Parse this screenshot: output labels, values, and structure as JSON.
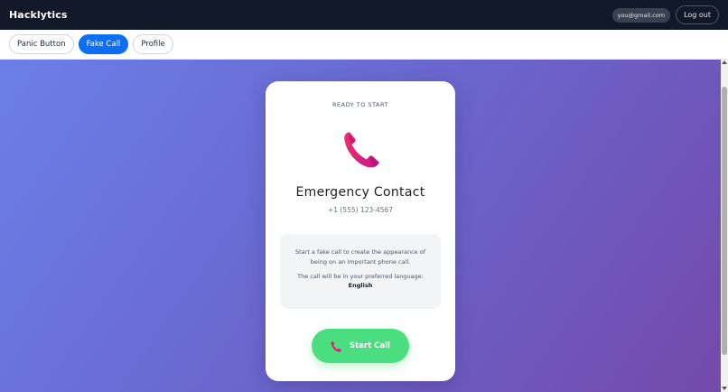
{
  "app": {
    "brand": "Hacklytics"
  },
  "header": {
    "email": "you@gmail.com",
    "logout_label": "Log out"
  },
  "tabs": [
    {
      "label": "Panic Button",
      "active": false
    },
    {
      "label": "Fake Call",
      "active": true
    },
    {
      "label": "Profile",
      "active": false
    }
  ],
  "call_card": {
    "status": "READY TO START",
    "icon": "phone-handset-icon",
    "contact_name": "Emergency Contact",
    "contact_number": "+1 (555) 123-4567",
    "info_text": "Start a fake call to create the appearance of being on an important phone call.",
    "language_label": "The call will be in your preferred language:",
    "language": "English",
    "start_label": "Start Call"
  },
  "colors": {
    "topbar": "#111827",
    "active_tab": "#0b6ef5",
    "gradient_start": "#6b7fe8",
    "gradient_end": "#7449ab",
    "start_button": "#4ade80",
    "phone_icon": "#e11d74"
  }
}
